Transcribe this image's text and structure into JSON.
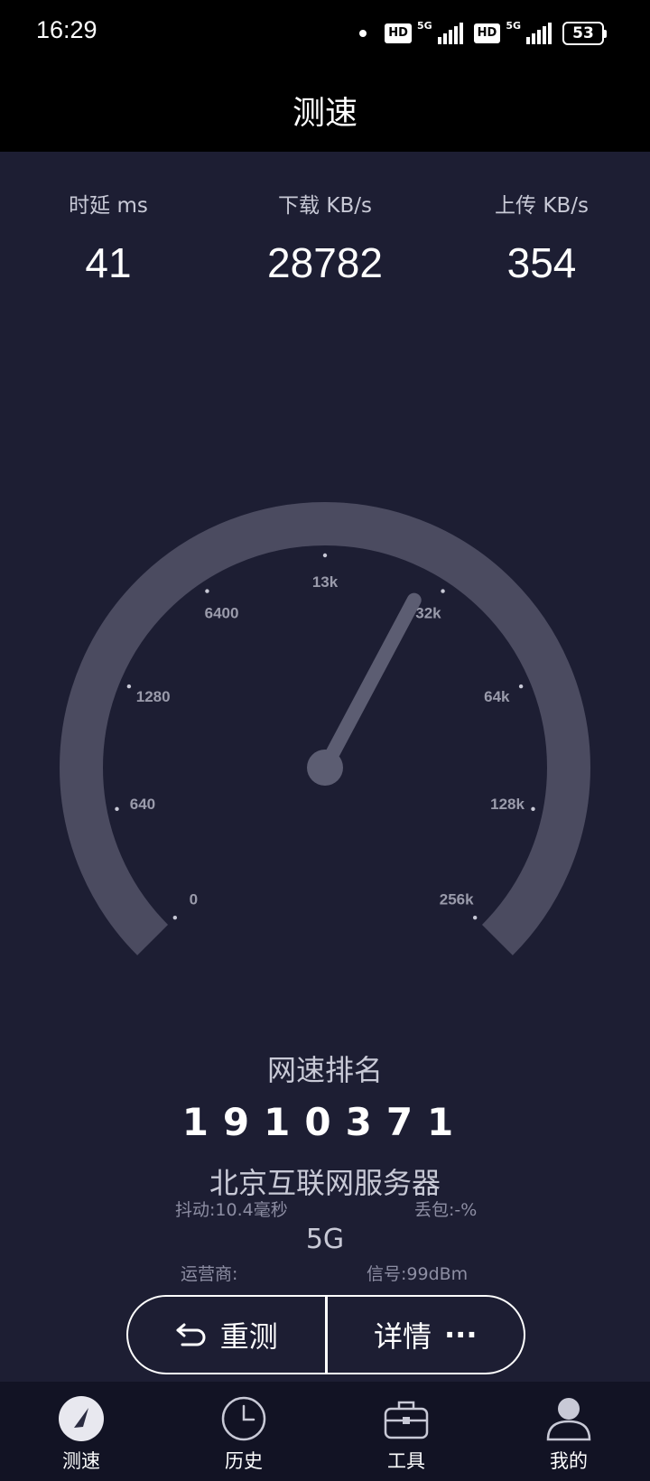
{
  "status_bar": {
    "time": "16:29",
    "battery": "53",
    "network_1": "5G",
    "network_2": "5G",
    "hd_1": "HD",
    "hd_2": "HD"
  },
  "header": {
    "title": "测速"
  },
  "metrics": [
    {
      "label": "时延 ms",
      "value": "41"
    },
    {
      "label": "下载 KB/s",
      "value": "28782"
    },
    {
      "label": "上传 KB/s",
      "value": "354"
    }
  ],
  "gauge": {
    "tick_labels": [
      "0",
      "640",
      "1280",
      "6400",
      "13k",
      "32k",
      "64k",
      "128k",
      "256k"
    ],
    "needle_value": "28782",
    "track_color": "#4b4b60",
    "needle_color": "#5c5d72"
  },
  "info": {
    "rank_title": "网速排名",
    "rank_value": "1910371",
    "server": "北京互联网服务器",
    "jitter": "抖动:10.4毫秒",
    "packet_loss": "丢包:-%",
    "network_type": "5G",
    "carrier": "运营商:",
    "signal": "信号:99dBm"
  },
  "actions": {
    "retest": "重测",
    "details": "详情",
    "details_suffix": "···"
  },
  "tabs": [
    {
      "label": "测速",
      "icon": "speedometer-icon"
    },
    {
      "label": "历史",
      "icon": "clock-icon"
    },
    {
      "label": "工具",
      "icon": "toolbox-icon"
    },
    {
      "label": "我的",
      "icon": "user-icon"
    }
  ]
}
